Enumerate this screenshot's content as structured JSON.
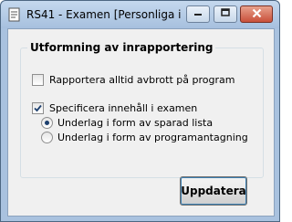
{
  "window": {
    "title": "RS41 - Examen [Personliga inst..."
  },
  "titlebar_buttons": {
    "minimize_icon": "minimize-icon",
    "maximize_icon": "maximize-icon",
    "close_icon": "close-icon"
  },
  "group": {
    "title": "Utformning av inrapportering",
    "checkbox_abort": {
      "label": "Rapportera alltid avbrott på program",
      "checked": false
    },
    "checkbox_specify": {
      "label": "Specificera innehåll i examen",
      "checked": true
    },
    "radio_saved_list": {
      "label": "Underlag i form av sparad lista",
      "selected": true
    },
    "radio_program": {
      "label": "Underlag i form av programantagning",
      "selected": false
    }
  },
  "buttons": {
    "update_label": "Uppdatera"
  },
  "colors": {
    "titlebar": "#a9c2df",
    "client_bg": "#f0f0f0",
    "close_button": "#c9503a"
  }
}
